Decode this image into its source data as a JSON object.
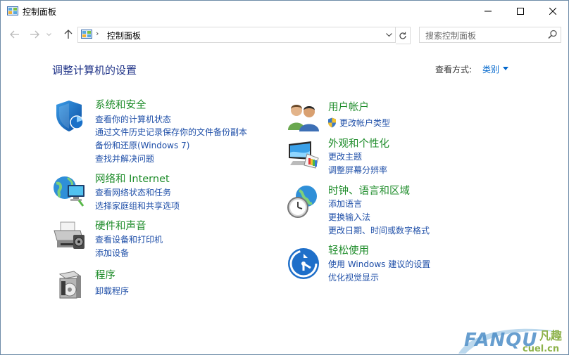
{
  "window": {
    "title": "控制面板"
  },
  "address": {
    "path": "控制面板",
    "separator": "›"
  },
  "search": {
    "placeholder": "搜索控制面板"
  },
  "main": {
    "heading": "调整计算机的设置",
    "view_by_label": "查看方式:",
    "view_by_value": "类别"
  },
  "categories": {
    "system_security": {
      "title": "系统和安全",
      "links": [
        "查看你的计算机状态",
        "通过文件历史记录保存你的文件备份副本",
        "备份和还原(Windows 7)",
        "查找并解决问题"
      ]
    },
    "network": {
      "title": "网络和 Internet",
      "links": [
        "查看网络状态和任务",
        "选择家庭组和共享选项"
      ]
    },
    "hardware": {
      "title": "硬件和声音",
      "links": [
        "查看设备和打印机",
        "添加设备"
      ]
    },
    "programs": {
      "title": "程序",
      "links": [
        "卸载程序"
      ]
    },
    "user_accounts": {
      "title": "用户帐户",
      "links": [
        "更改帐户类型"
      ]
    },
    "appearance": {
      "title": "外观和个性化",
      "links": [
        "更改主题",
        "调整屏幕分辨率"
      ]
    },
    "clock_region": {
      "title": "时钟、语言和区域",
      "links": [
        "添加语言",
        "更换输入法",
        "更改日期、时间或数字格式"
      ]
    },
    "ease_of_access": {
      "title": "轻松使用",
      "links": [
        "使用 Windows 建议的设置",
        "优化视觉显示"
      ]
    }
  },
  "watermark": {
    "brand": "FANQU",
    "site": "cuel.cn",
    "cn": "凡趣"
  },
  "colors": {
    "category_title": "#1e8c2a",
    "link": "#1f4fa8",
    "heading": "#1e3287"
  }
}
